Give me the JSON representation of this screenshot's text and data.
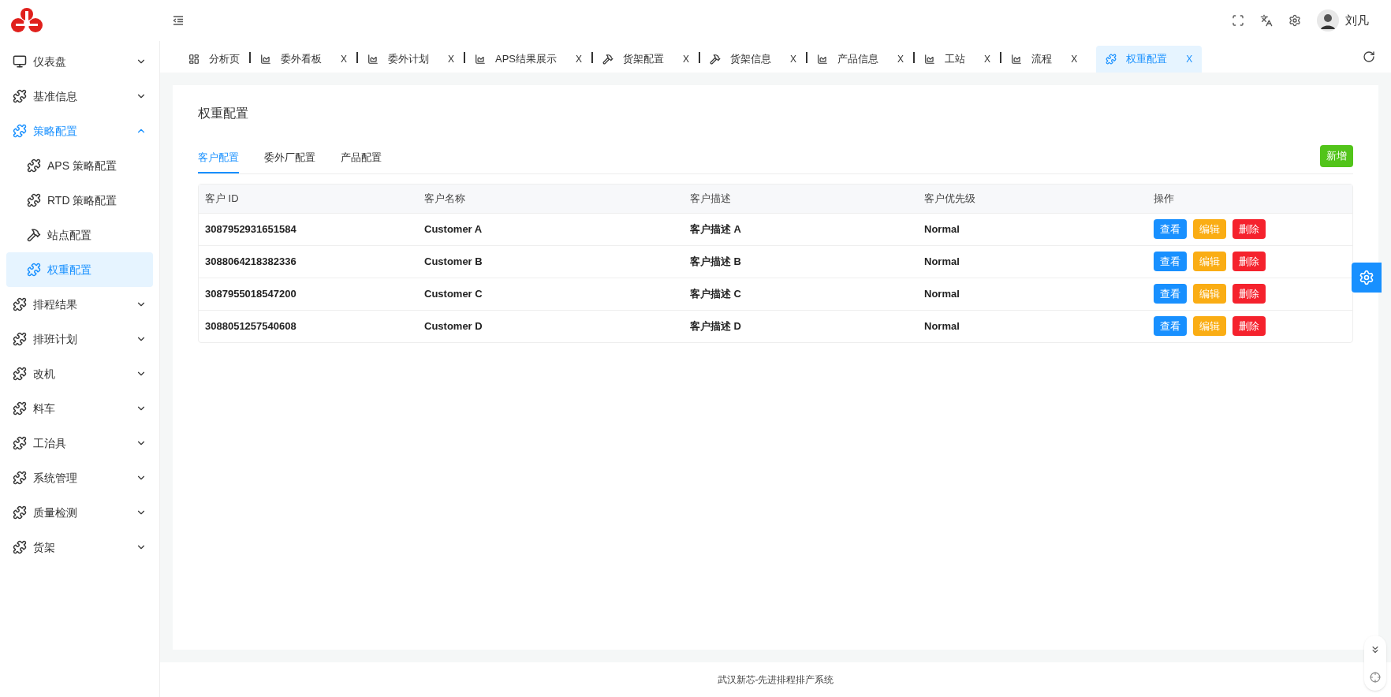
{
  "header": {
    "user": {
      "name": "刘凡"
    }
  },
  "sidebar": {
    "items": [
      {
        "label": "仪表盘",
        "kind": "monitor",
        "expanded": false,
        "selected": false
      },
      {
        "label": "基准信息",
        "kind": "puzzle",
        "expanded": false,
        "selected": false
      },
      {
        "label": "策略配置",
        "kind": "puzzle",
        "expanded": true,
        "selected": false,
        "children": [
          {
            "label": "APS 策略配置",
            "kind": "puzzle",
            "selected": false
          },
          {
            "label": "RTD 策略配置",
            "kind": "puzzle",
            "selected": false
          },
          {
            "label": "站点配置",
            "kind": "tools",
            "selected": false
          },
          {
            "label": "权重配置",
            "kind": "puzzle",
            "selected": true
          }
        ]
      },
      {
        "label": "排程结果",
        "kind": "puzzle",
        "expanded": false,
        "selected": false
      },
      {
        "label": "排班计划",
        "kind": "puzzle",
        "expanded": false,
        "selected": false
      },
      {
        "label": "改机",
        "kind": "puzzle",
        "expanded": false,
        "selected": false
      },
      {
        "label": "料车",
        "kind": "puzzle",
        "expanded": false,
        "selected": false
      },
      {
        "label": "工治具",
        "kind": "puzzle",
        "expanded": false,
        "selected": false
      },
      {
        "label": "系统管理",
        "kind": "puzzle",
        "expanded": false,
        "selected": false
      },
      {
        "label": "质量检测",
        "kind": "puzzle",
        "expanded": false,
        "selected": false
      },
      {
        "label": "货架",
        "kind": "puzzle",
        "expanded": false,
        "selected": false
      }
    ]
  },
  "page_tabs": [
    {
      "label": "分析页",
      "kind": "dashboard",
      "selected": false
    },
    {
      "label": "委外看板",
      "kind": "chart",
      "close": "X",
      "selected": false
    },
    {
      "label": "委外计划",
      "kind": "chart",
      "close": "X",
      "selected": false
    },
    {
      "label": "APS结果展示",
      "kind": "chart",
      "close": "X",
      "selected": false
    },
    {
      "label": "货架配置",
      "kind": "tools",
      "close": "X",
      "selected": false
    },
    {
      "label": "货架信息",
      "kind": "tools",
      "close": "X",
      "selected": false
    },
    {
      "label": "产品信息",
      "kind": "chart",
      "close": "X",
      "selected": false
    },
    {
      "label": "工站",
      "kind": "chart",
      "close": "X",
      "selected": false
    },
    {
      "label": "流程",
      "kind": "chart",
      "close": "X",
      "selected": false
    },
    {
      "label": "权重配置",
      "kind": "puzzle",
      "close": "X",
      "selected": true
    }
  ],
  "content": {
    "title": "权重配置",
    "tabs": [
      {
        "label": "客户配置",
        "selected": true
      },
      {
        "label": "委外厂配置",
        "selected": false
      },
      {
        "label": "产品配置",
        "selected": false
      }
    ],
    "add_button": "新增",
    "table": {
      "columns": [
        "客户 ID",
        "客户名称",
        "客户描述",
        "客户优先级",
        "操作"
      ],
      "rows": [
        {
          "id": "3087952931651584",
          "name": "Customer A",
          "description": "客户描述 A",
          "priority": "Normal",
          "actions": [
            {
              "label": "查看",
              "kind": "view"
            },
            {
              "label": "编辑",
              "kind": "edit"
            },
            {
              "label": "删除",
              "kind": "delete"
            }
          ]
        },
        {
          "id": "3088064218382336",
          "name": "Customer B",
          "description": "客户描述 B",
          "priority": "Normal",
          "actions": [
            {
              "label": "查看",
              "kind": "view"
            },
            {
              "label": "编辑",
              "kind": "edit"
            },
            {
              "label": "删除",
              "kind": "delete"
            }
          ]
        },
        {
          "id": "3087955018547200",
          "name": "Customer C",
          "description": "客户描述 C",
          "priority": "Normal",
          "actions": [
            {
              "label": "查看",
              "kind": "view"
            },
            {
              "label": "编辑",
              "kind": "edit"
            },
            {
              "label": "删除",
              "kind": "delete"
            }
          ]
        },
        {
          "id": "3088051257540608",
          "name": "Customer D",
          "description": "客户描述 D",
          "priority": "Normal",
          "actions": [
            {
              "label": "查看",
              "kind": "view"
            },
            {
              "label": "编辑",
              "kind": "edit"
            },
            {
              "label": "删除",
              "kind": "delete"
            }
          ]
        }
      ]
    }
  },
  "footer": "武汉新芯-先进排程排产系统"
}
